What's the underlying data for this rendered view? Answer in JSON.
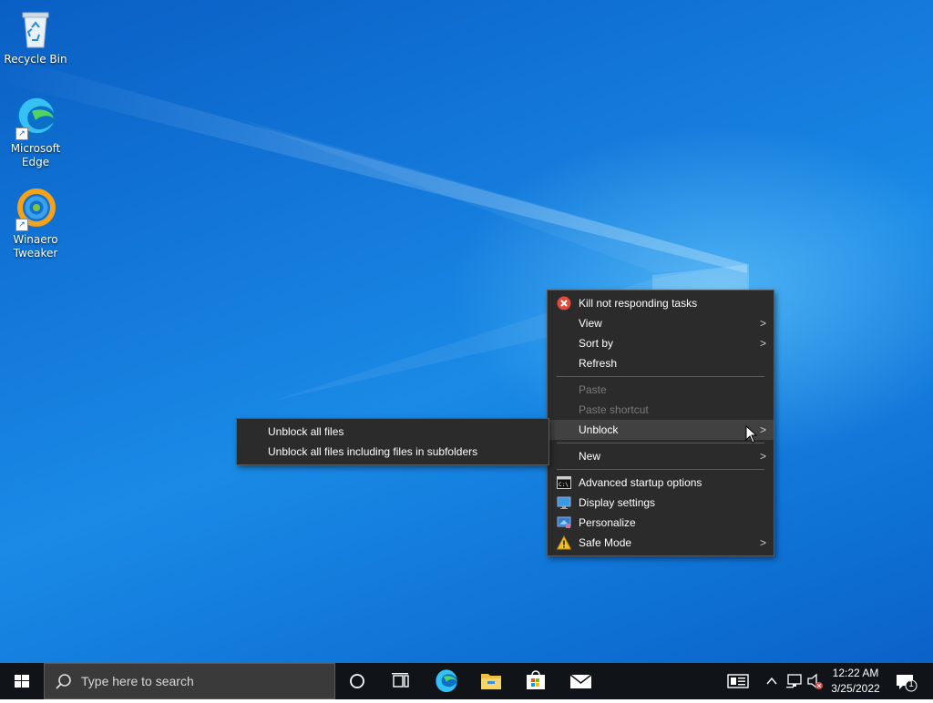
{
  "desktop": {
    "icons": [
      {
        "label": "Recycle Bin"
      },
      {
        "label": "Microsoft Edge"
      },
      {
        "label": "Winaero Tweaker"
      }
    ]
  },
  "context_menu": {
    "items": {
      "kill": "Kill not responding tasks",
      "view": "View",
      "sort_by": "Sort by",
      "refresh": "Refresh",
      "paste": "Paste",
      "paste_shortcut": "Paste shortcut",
      "unblock": "Unblock",
      "new": "New",
      "advanced_startup": "Advanced startup options",
      "display_settings": "Display settings",
      "personalize": "Personalize",
      "safe_mode": "Safe Mode"
    }
  },
  "submenu": {
    "items": {
      "unblock_all": "Unblock all files",
      "unblock_all_sub": "Unblock all files including files in subfolders"
    }
  },
  "taskbar": {
    "search_placeholder": "Type here to search",
    "clock_time": "12:22 AM",
    "clock_date": "3/25/2022",
    "notification_count": "1"
  },
  "colors": {
    "menu_bg": "#2b2b2b",
    "desktop_blue": "#1276d8",
    "taskbar_bg": "#101418"
  }
}
